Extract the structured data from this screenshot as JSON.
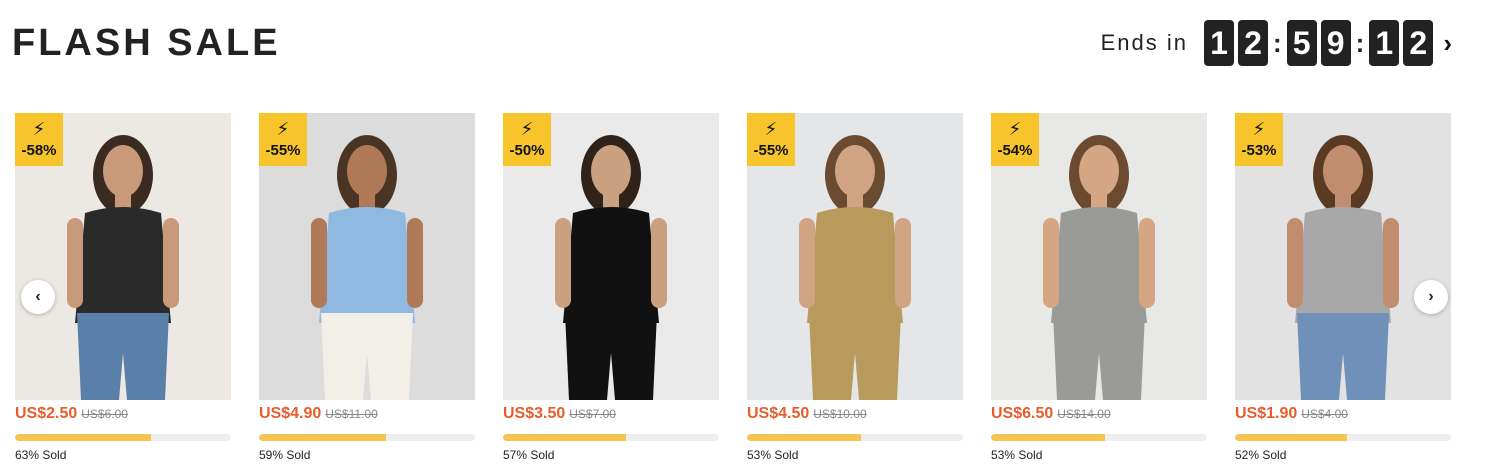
{
  "header": {
    "title": "FLASH SALE",
    "ends_label": "Ends in",
    "timer": {
      "h1": "1",
      "h2": "2",
      "m1": "5",
      "m2": "9",
      "s1": "1",
      "s2": "2"
    },
    "timer_separator": ":",
    "next_icon": "chevron-right-icon"
  },
  "carousel": {
    "prev_icon": "chevron-left-icon",
    "next_icon": "chevron-right-icon"
  },
  "products": [
    {
      "discount": "-58%",
      "price": "US$2.50",
      "old_price": "US$6.00",
      "sold_pct": 63,
      "sold_label": "63% Sold",
      "bg": "#ece8e4",
      "dress": "#2a2a2a",
      "skin": "#c89a7a",
      "hair": "#3a2a20",
      "bottom": "#5a7fa8"
    },
    {
      "discount": "-55%",
      "price": "US$4.90",
      "old_price": "US$11.00",
      "sold_pct": 59,
      "sold_label": "59% Sold",
      "bg": "#dcdcdc",
      "dress": "#8fb9e0",
      "skin": "#b07a58",
      "hair": "#4a3525",
      "bottom": "#f2efe8"
    },
    {
      "discount": "-50%",
      "price": "US$3.50",
      "old_price": "US$7.00",
      "sold_pct": 57,
      "sold_label": "57% Sold",
      "bg": "#eaeaea",
      "dress": "#111111",
      "skin": "#c9a080",
      "hair": "#2f2218",
      "bottom": "#111111"
    },
    {
      "discount": "-55%",
      "price": "US$4.50",
      "old_price": "US$10.00",
      "sold_pct": 53,
      "sold_label": "53% Sold",
      "bg": "#e4e6e8",
      "dress": "#b89a5c",
      "skin": "#d0a482",
      "hair": "#6a4a30",
      "bottom": "#b89a5c"
    },
    {
      "discount": "-54%",
      "price": "US$6.50",
      "old_price": "US$14.00",
      "sold_pct": 53,
      "sold_label": "53% Sold",
      "bg": "#e8e8e6",
      "dress": "#9a9a96",
      "skin": "#d4a684",
      "hair": "#6b4a2f",
      "bottom": "#9a9a96"
    },
    {
      "discount": "-53%",
      "price": "US$1.90",
      "old_price": "US$4.00",
      "sold_pct": 52,
      "sold_label": "52% Sold",
      "bg": "#e2e2e2",
      "dress": "#a8a8a8",
      "skin": "#c08e6e",
      "hair": "#5a3a22",
      "bottom": "#6f90b8"
    }
  ]
}
